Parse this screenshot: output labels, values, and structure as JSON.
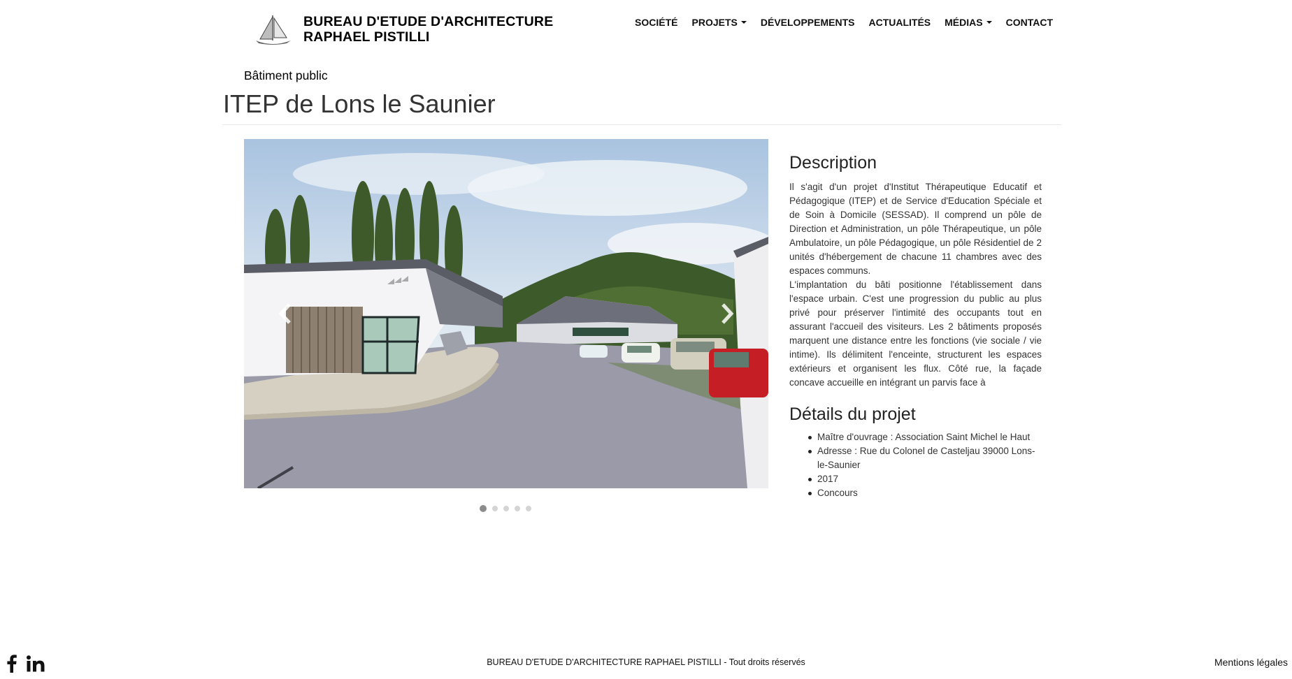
{
  "header": {
    "brand_line1": "BUREAU D'ETUDE D'ARCHITECTURE",
    "brand_line2": "RAPHAEL PISTILLI",
    "nav": [
      {
        "label": "SOCIÉTÉ",
        "dropdown": false
      },
      {
        "label": "PROJETS",
        "dropdown": true
      },
      {
        "label": "DÉVELOPPEMENTS",
        "dropdown": false
      },
      {
        "label": "ACTUALITÉS",
        "dropdown": false
      },
      {
        "label": "MÉDIAS",
        "dropdown": true
      },
      {
        "label": "CONTACT",
        "dropdown": false
      }
    ]
  },
  "project": {
    "category": "Bâtiment public",
    "title": "ITEP de Lons le Saunier"
  },
  "carousel": {
    "slide_count": 5,
    "active_index": 0,
    "prev_icon": "chevron-left-icon",
    "next_icon": "chevron-right-icon"
  },
  "description": {
    "heading": "Description",
    "paragraph1": "Il s'agit d'un projet d'Institut Thérapeutique Educatif et Pédagogique (ITEP) et de Service d'Education Spéciale et de Soin à Domicile (SESSAD). Il comprend un pôle de Direction et Administration, un pôle Thérapeutique, un pôle Ambulatoire, un pôle Pédagogique, un pôle Résidentiel de 2 unités d'hébergement de chacune 11 chambres avec des espaces communs.",
    "paragraph2": "L'implantation du bâti positionne l'établissement dans l'espace urbain. C'est une progression du public au plus privé pour préserver l'intimité des occupants tout en assurant l'accueil des visiteurs. Les 2 bâtiments proposés marquent une distance entre les fonctions (vie sociale / vie intime). Ils délimitent l'enceinte, structurent les espaces extérieurs et organisent les flux. Côté rue, la façade concave accueille en intégrant un parvis face à"
  },
  "details": {
    "heading": "Détails du projet",
    "items": [
      "Maître d'ouvrage : Association Saint Michel le Haut",
      "Adresse : Rue du Colonel de Casteljau 39000 Lons-le-Saunier",
      "2017",
      "Concours"
    ]
  },
  "footer": {
    "copyright": "BUREAU D'ETUDE D'ARCHITECTURE RAPHAEL PISTILLI - Tout droits réservés",
    "legal": "Mentions légales",
    "social": [
      "facebook-icon",
      "linkedin-icon"
    ]
  },
  "colors": {
    "text": "#333333",
    "sky": "#c9d9ea",
    "road": "#9a9aa8",
    "active_dot": "#8c8c8c",
    "inactive_dot": "#d4d4d4"
  }
}
